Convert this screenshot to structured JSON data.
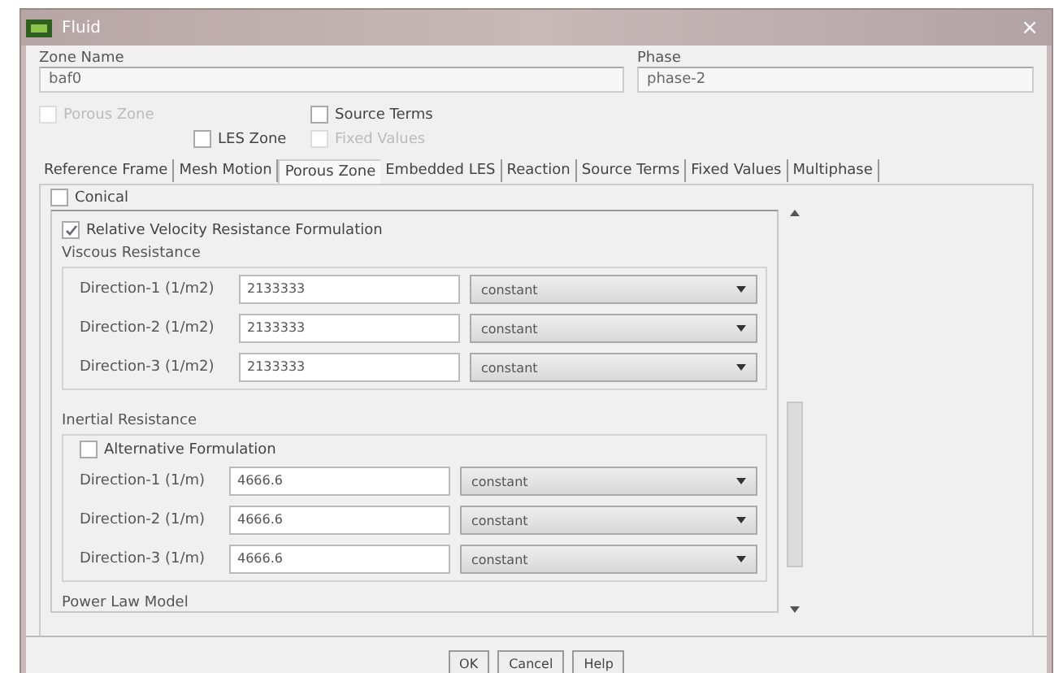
{
  "window": {
    "title": "Fluid",
    "close": "×"
  },
  "zone_name": {
    "label": "Zone Name",
    "value": "baf0"
  },
  "phase": {
    "label": "Phase",
    "value": "phase-2"
  },
  "options": [
    {
      "label": "Porous Zone",
      "checked": false,
      "disabled": true
    },
    {
      "label": "Source Terms",
      "checked": false,
      "disabled": false
    },
    {
      "label": "LES Zone",
      "checked": false,
      "disabled": false
    },
    {
      "label": "Fixed Values",
      "checked": false,
      "disabled": true
    }
  ],
  "tabs": [
    {
      "label": "Reference Frame",
      "selected": false
    },
    {
      "label": "Mesh Motion",
      "selected": false
    },
    {
      "label": "Porous Zone",
      "selected": true
    },
    {
      "label": "Embedded LES",
      "selected": false
    },
    {
      "label": "Reaction",
      "selected": false
    },
    {
      "label": "Source Terms",
      "selected": false
    },
    {
      "label": "Fixed Values",
      "selected": false
    },
    {
      "label": "Multiphase",
      "selected": false
    }
  ],
  "conical": {
    "label": "Conical",
    "checked": false
  },
  "relative_velocity": {
    "label": "Relative Velocity Resistance Formulation",
    "checked": true
  },
  "viscous": {
    "title": "Viscous Resistance",
    "rows": [
      {
        "label": "Direction-1 (1/m2)",
        "value": "2133333",
        "method": "constant"
      },
      {
        "label": "Direction-2 (1/m2)",
        "value": "2133333",
        "method": "constant"
      },
      {
        "label": "Direction-3 (1/m2)",
        "value": "2133333",
        "method": "constant"
      }
    ]
  },
  "inertial": {
    "title": "Inertial Resistance",
    "alternative": {
      "label": "Alternative Formulation",
      "checked": false
    },
    "rows": [
      {
        "label": "Direction-1 (1/m)",
        "value": "4666.6",
        "method": "constant"
      },
      {
        "label": "Direction-2 (1/m)",
        "value": "4666.6",
        "method": "constant"
      },
      {
        "label": "Direction-3 (1/m)",
        "value": "4666.6",
        "method": "constant"
      }
    ]
  },
  "power_law": {
    "title": "Power Law Model"
  },
  "buttons": [
    "OK",
    "Cancel",
    "Help"
  ]
}
